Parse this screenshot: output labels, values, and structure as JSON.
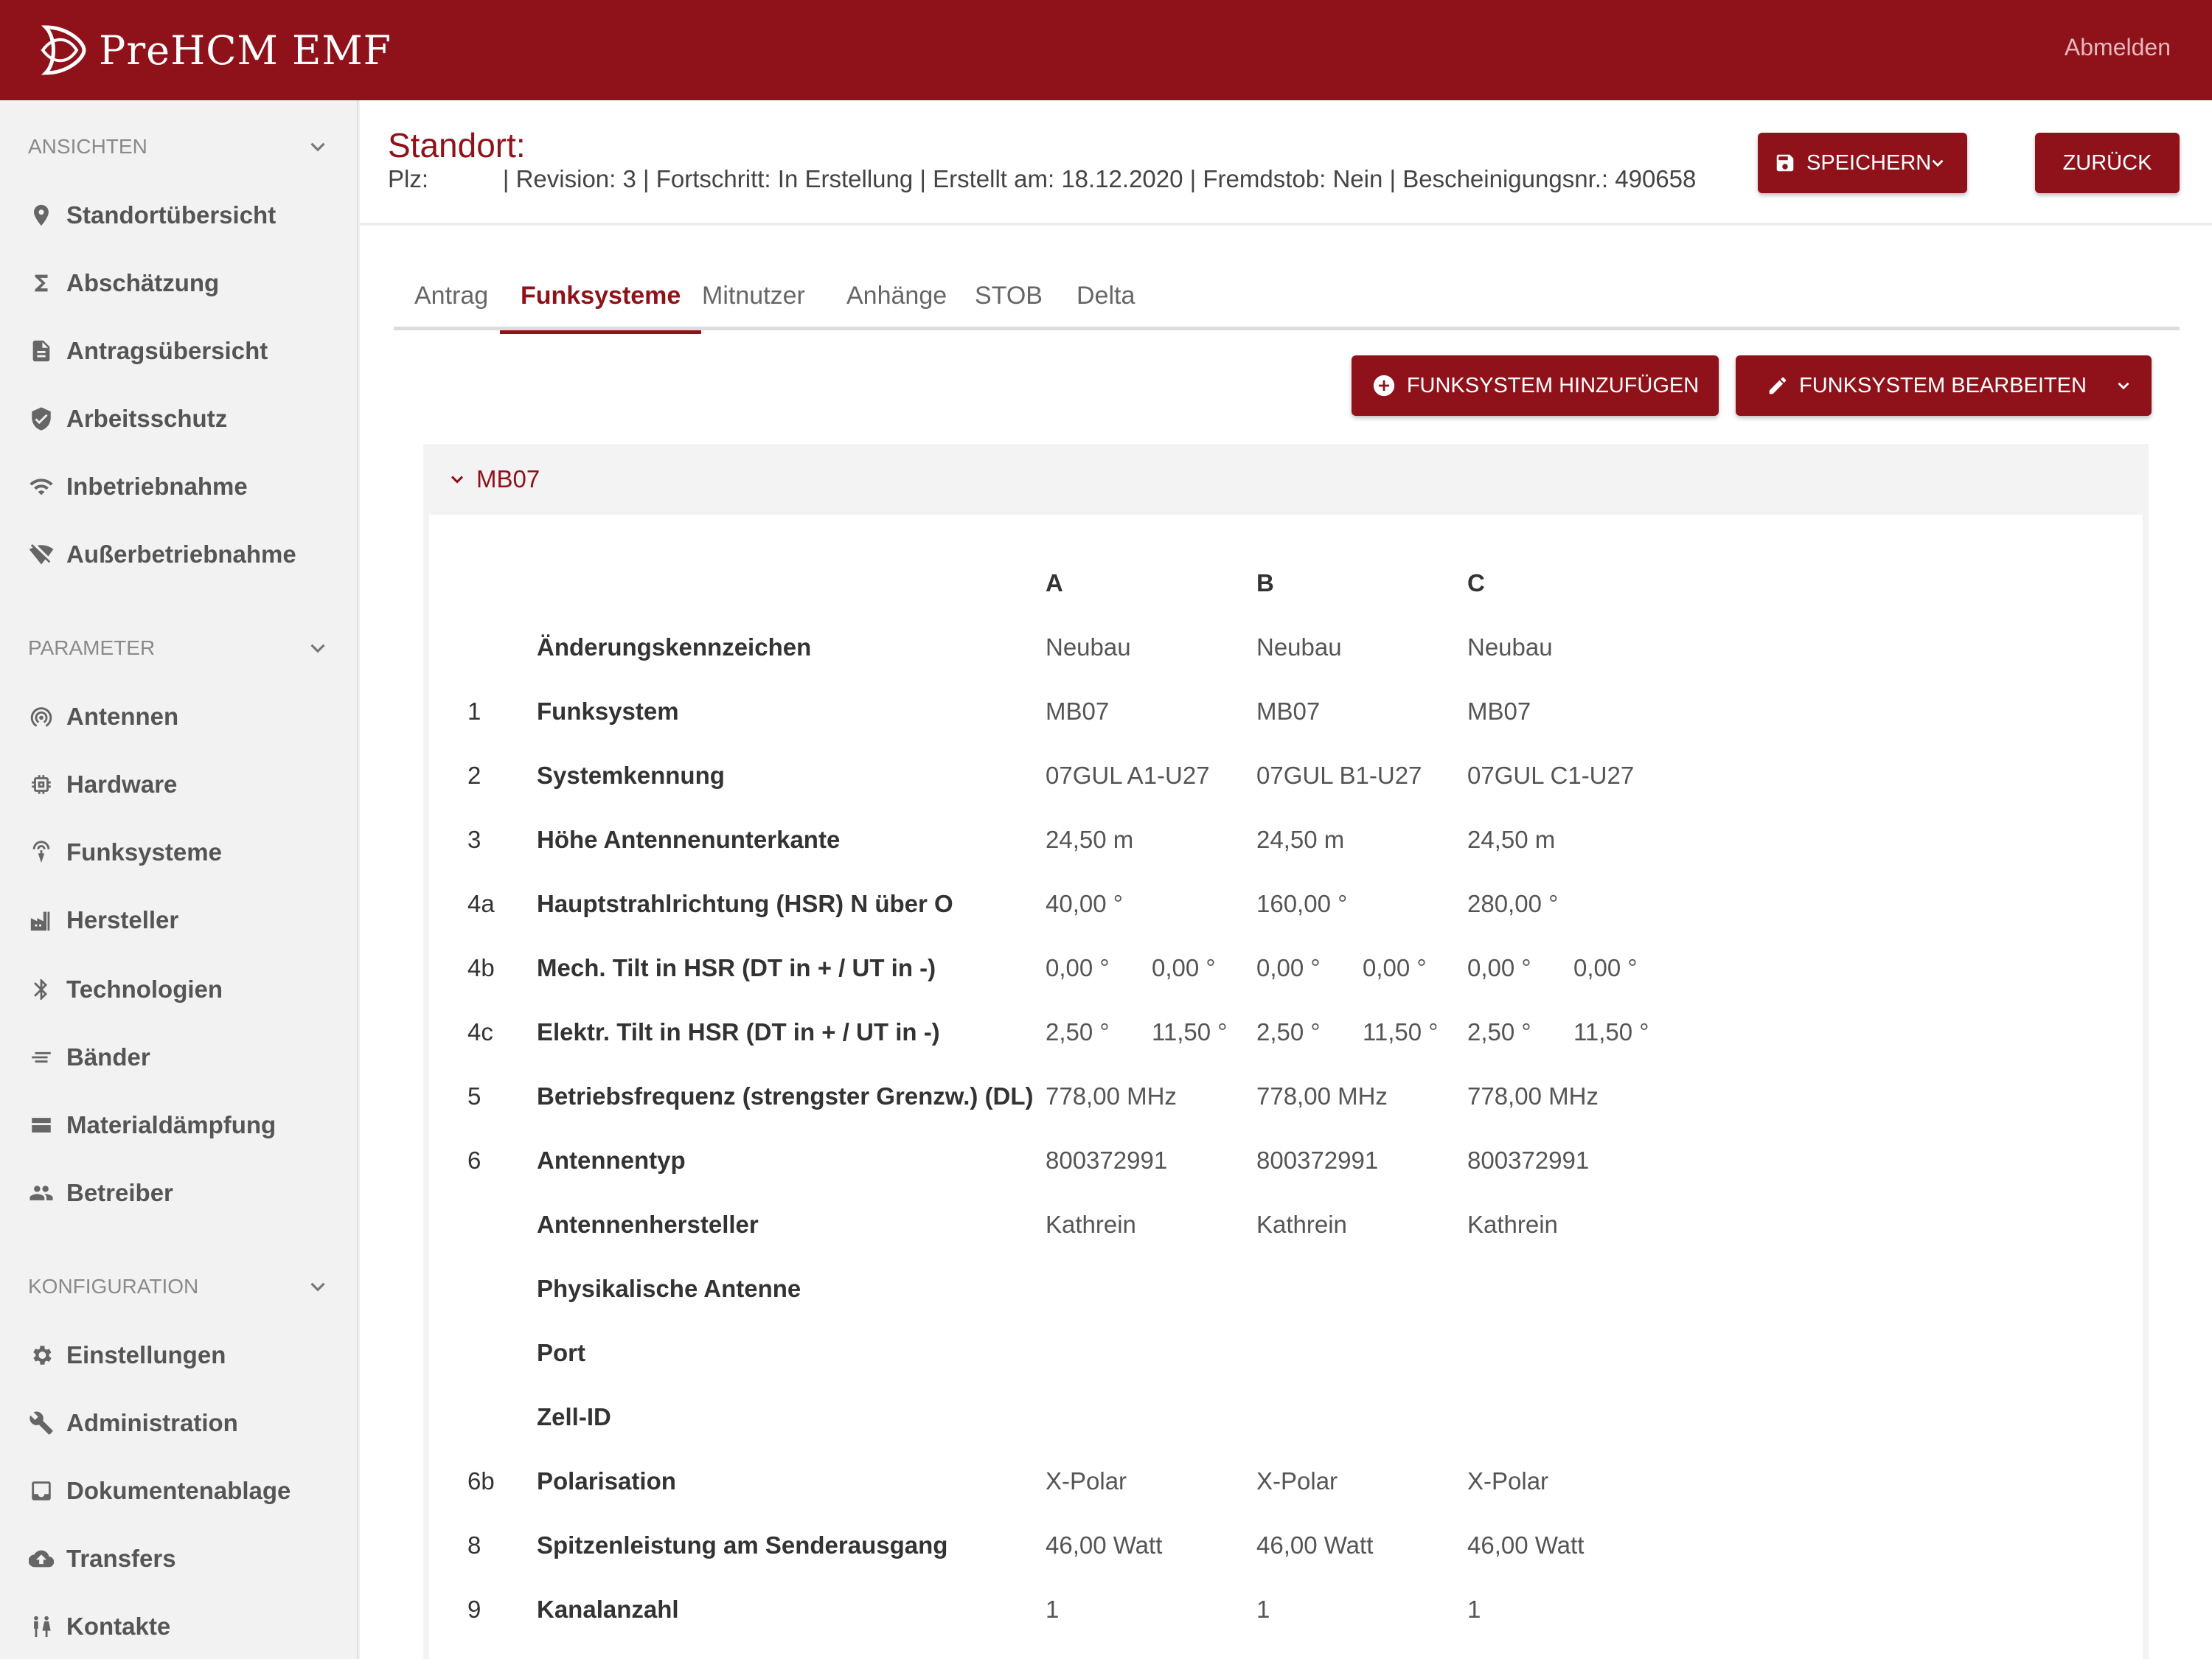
{
  "header": {
    "brand": "PreHCM  EMF",
    "logout": "Abmelden"
  },
  "sidebar": {
    "sections": [
      {
        "title": "ANSICHTEN",
        "items": [
          "Standortübersicht",
          "Abschätzung",
          "Antragsübersicht",
          "Arbeitsschutz",
          "Inbetriebnahme",
          "Außerbetriebnahme"
        ]
      },
      {
        "title": "PARAMETER",
        "items": [
          "Antennen",
          "Hardware",
          "Funksysteme",
          "Hersteller",
          "Technologien",
          "Bänder",
          "Materialdämpfung",
          "Betreiber"
        ]
      },
      {
        "title": "KONFIGURATION",
        "items": [
          "Einstellungen",
          "Administration",
          "Dokumentenablage",
          "Transfers",
          "Kontakte"
        ]
      }
    ]
  },
  "page": {
    "title": "Standort:",
    "subline": "Plz:           | Revision: 3 | Fortschritt: In Erstellung | Erstellt am: 18.12.2020 | Fremdstob: Nein | Bescheinigungsnr.: 490658",
    "save_label": "SPEICHERN",
    "back_label": "ZURÜCK",
    "tabs": [
      "Antrag",
      "Funksysteme",
      "Mitnutzer",
      "Anhänge",
      "STOB",
      "Delta"
    ],
    "add_label": "FUNKSYSTEM HINZUFÜGEN",
    "edit_label": "FUNKSYSTEM BEARBEITEN"
  },
  "panel": {
    "title": "MB07",
    "columns": [
      "A",
      "B",
      "C"
    ],
    "rows": [
      {
        "num": "",
        "label": "Änderungskennzeichen",
        "a": "Neubau",
        "b": "Neubau",
        "c": "Neubau"
      },
      {
        "num": "1",
        "label": "Funksystem",
        "a": "MB07",
        "b": "MB07",
        "c": "MB07"
      },
      {
        "num": "2",
        "label": "Systemkennung",
        "a": "07GUL A1-U27",
        "b": "07GUL B1-U27",
        "c": "07GUL C1-U27"
      },
      {
        "num": "3",
        "label": "Höhe Antennenunterkante",
        "a": "24,50 m",
        "b": "24,50 m",
        "c": "24,50 m"
      },
      {
        "num": "4a",
        "label": "Hauptstrahlrichtung (HSR) N über O",
        "a": "40,00 °",
        "b": "160,00 °",
        "c": "280,00 °"
      },
      {
        "num": "4b",
        "label": "Mech. Tilt in HSR (DT in + / UT in -)",
        "a": "0,00 °",
        "a2": "0,00 °",
        "b": "0,00 °",
        "b2": "0,00 °",
        "c": "0,00 °",
        "c2": "0,00 °"
      },
      {
        "num": "4c",
        "label": "Elektr. Tilt in HSR (DT in + / UT in -)",
        "a": "2,50 °",
        "a2": "11,50 °",
        "b": "2,50 °",
        "b2": "11,50 °",
        "c": "2,50 °",
        "c2": "11,50 °"
      },
      {
        "num": "5",
        "label": "Betriebsfrequenz (strengster Grenzw.) (DL)",
        "a": "778,00 MHz",
        "b": "778,00 MHz",
        "c": "778,00 MHz"
      },
      {
        "num": "6",
        "label": "Antennentyp",
        "a": "800372991",
        "b": "800372991",
        "c": "800372991"
      },
      {
        "num": "",
        "label": "Antennenhersteller",
        "a": "Kathrein",
        "b": "Kathrein",
        "c": "Kathrein"
      },
      {
        "num": "",
        "label": "Physikalische Antenne",
        "a": "",
        "b": "",
        "c": ""
      },
      {
        "num": "",
        "label": "Port",
        "a": "",
        "b": "",
        "c": ""
      },
      {
        "num": "",
        "label": "Zell-ID",
        "a": "",
        "b": "",
        "c": ""
      },
      {
        "num": "6b",
        "label": "Polarisation",
        "a": "X-Polar",
        "b": "X-Polar",
        "c": "X-Polar"
      },
      {
        "num": "8",
        "label": "Spitzenleistung am Senderausgang",
        "a": "46,00 Watt",
        "b": "46,00 Watt",
        "c": "46,00 Watt"
      },
      {
        "num": "9",
        "label": "Kanalanzahl",
        "a": "1",
        "b": "1",
        "c": "1"
      }
    ]
  },
  "colors": {
    "brand": "#8f121a",
    "sidebar_bg": "#f2f2f2"
  }
}
